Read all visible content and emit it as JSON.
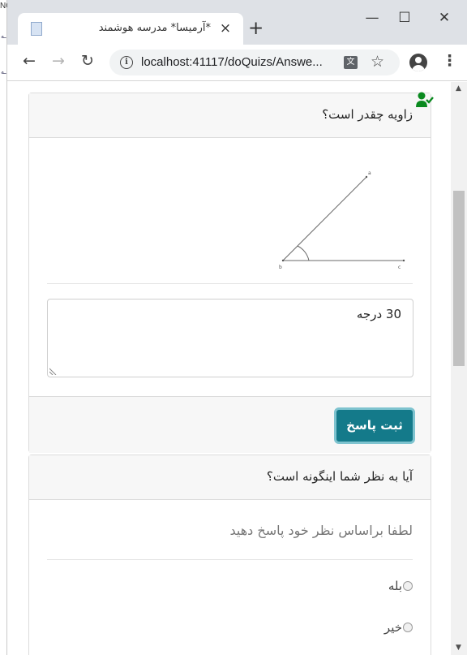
{
  "browser": {
    "tab_title": "*آرمیسا* مدرسه هوشمند",
    "tab_close": "×",
    "new_tab": "+",
    "window_controls": {
      "minimize": "—",
      "maximize": "☐",
      "close": "✕"
    },
    "nav": {
      "back": "←",
      "forward": "→",
      "reload": "↻"
    },
    "url": "localhost:41117/doQuizs/Answe...",
    "menu": "⋮",
    "star": "☆",
    "behind_window_text": "NC",
    "behind_window_marks": [
      "ـه",
      "ـه"
    ]
  },
  "icons": {
    "user_check": "user-check-icon",
    "info": "info-icon",
    "translate": "translate-icon",
    "profile": "profile-icon",
    "colors": {
      "user_check": "#0a8a1f",
      "submit_bg": "#147a8a",
      "submit_ring": "#7ec3cf"
    }
  },
  "quiz": {
    "question1": {
      "text": "زاویه چقدر است؟",
      "diagram_vertex_labels": [
        "a",
        "b",
        "c"
      ],
      "answer_value": "30 درجه",
      "submit_label": "ثبت پاسخ"
    },
    "question2": {
      "text": "آیا به نظر شما اینگونه است؟",
      "hint": "لطفا براساس نظر خود پاسخ دهید",
      "options": [
        {
          "label": "بله",
          "selected": false
        },
        {
          "label": "خیر",
          "selected": false
        }
      ]
    }
  }
}
